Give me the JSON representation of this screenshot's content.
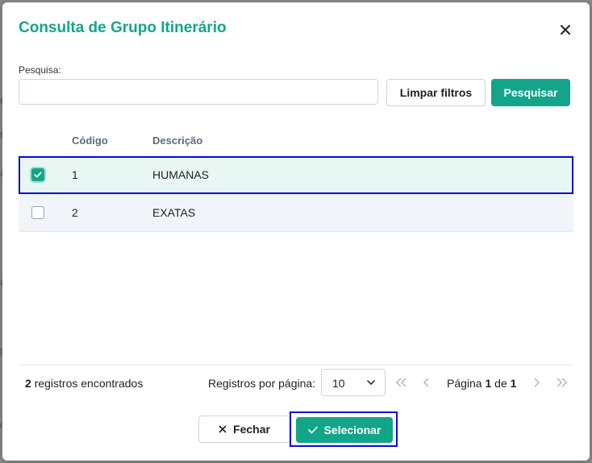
{
  "modal": {
    "title": "Consulta de Grupo Itinerário",
    "search": {
      "label": "Pesquisa:",
      "value": "",
      "placeholder": ""
    },
    "buttons": {
      "clear": "Limpar filtros",
      "search": "Pesquisar",
      "close": "Fechar",
      "select": "Selecionar"
    },
    "table": {
      "columns": [
        "Código",
        "Descrição"
      ],
      "rows": [
        {
          "code": "1",
          "description": "HUMANAS",
          "checked": true
        },
        {
          "code": "2",
          "description": "EXATAS",
          "checked": false
        }
      ]
    },
    "footer": {
      "records_count": "2",
      "records_label": "registros encontrados",
      "per_page_label": "Registros por página:",
      "per_page_value": "10",
      "page_label": "Página",
      "page_current": "1",
      "page_of": "de",
      "page_total": "1"
    }
  },
  "colors": {
    "accent": "#13a58a",
    "highlight_border": "#0a0ad8",
    "selected_row": "#e9f7f4"
  },
  "icons": [
    "close-icon",
    "check-icon",
    "chevron-down-icon",
    "first-page-icon",
    "prev-page-icon",
    "next-page-icon",
    "last-page-icon"
  ]
}
